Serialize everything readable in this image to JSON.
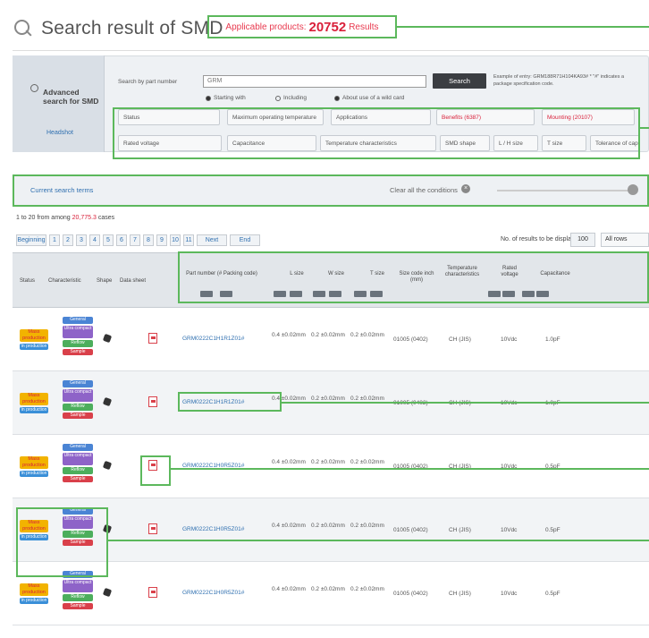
{
  "header": {
    "title": "Search result of SMD",
    "applicable_prefix": "Applicable products:",
    "applicable_count": "20752",
    "applicable_suffix": "Results"
  },
  "advanced": {
    "title": "Advanced search for SMD",
    "link": "Headshot"
  },
  "search": {
    "label": "Search by part number",
    "value": "GRM",
    "button": "Search",
    "example": "Example of entry: GRM188R71H104KA93# * \"#\" indicates a package specification code.",
    "radio_starting": "Starting with",
    "radio_including": "Including",
    "wildcard_note": "About use of a wild card"
  },
  "filters": [
    {
      "label": "Status",
      "red": false
    },
    {
      "label": "Maximum operating temperature",
      "red": false
    },
    {
      "label": "Applications",
      "red": false
    },
    {
      "label": "Benefits (6387)",
      "red": true
    },
    {
      "label": "Mounting (20107)",
      "red": true
    },
    {
      "label": "Rated voltage",
      "red": false
    },
    {
      "label": "Capacitance",
      "red": false
    },
    {
      "label": "Temperature characteristics",
      "red": false
    },
    {
      "label": "SMD shape",
      "red": false
    },
    {
      "label": "L / H size",
      "red": false
    },
    {
      "label": "T size",
      "red": false
    },
    {
      "label": "Tolerance of capacitance",
      "red": false
    }
  ],
  "current": {
    "title": "Current search terms",
    "clear": "Clear all the conditions"
  },
  "results": {
    "count_text": "1 to 20 from among",
    "count_num": "20,775.3",
    "count_suffix": "cases"
  },
  "pagination": {
    "items": [
      "Beginning",
      "1",
      "2",
      "3",
      "4",
      "5",
      "6",
      "7",
      "8",
      "9",
      "10",
      "11",
      "Next",
      "End"
    ]
  },
  "display": {
    "label": "No. of results to be displayed",
    "value": "100",
    "sort": "All rows"
  },
  "columns": {
    "status": "Status",
    "characteristic": "Characteristic",
    "shape": "Shape",
    "datasheet": "Data sheet",
    "part": "Part number (# Packing code)",
    "l": "L size",
    "w": "W size",
    "t": "T size",
    "sizecode": "Size code inch (mm)",
    "temp": "Temperature characteristics",
    "rated": "Rated voltage",
    "cap": "Capacitance"
  },
  "rows": [
    {
      "status": "Mass production",
      "status2": "In production",
      "part": "GRM0222C1H1R1Z01#",
      "l": "0.4 ±0.02mm",
      "w": "0.2 ±0.02mm",
      "t": "0.2 ±0.02mm",
      "size": "01005 (0402)",
      "temp": "CH (JIS)",
      "rated": "10Vdc",
      "cap": "1.0pF"
    },
    {
      "status": "Mass production",
      "status2": "In production",
      "part": "GRM0222C1H1R1Z01#",
      "l": "0.4 ±0.02mm",
      "w": "0.2 ±0.02mm",
      "t": "0.2 ±0.02mm",
      "size": "01005 (0402)",
      "temp": "CH (JIS)",
      "rated": "10Vdc",
      "cap": "1.0pF"
    },
    {
      "status": "Mass production",
      "status2": "In production",
      "part": "GRM0222C1H0R5Z01#",
      "l": "0.4 ±0.02mm",
      "w": "0.2 ±0.02mm",
      "t": "0.2 ±0.02mm",
      "size": "01005 (0402)",
      "temp": "CH (JIS)",
      "rated": "10Vdc",
      "cap": "0.5pF"
    },
    {
      "status": "Mass production",
      "status2": "In production",
      "part": "GRM0222C1H0R5Z01#",
      "l": "0.4 ±0.02mm",
      "w": "0.2 ±0.02mm",
      "t": "0.2 ±0.02mm",
      "size": "01005 (0402)",
      "temp": "CH (JIS)",
      "rated": "10Vdc",
      "cap": "0.5pF"
    },
    {
      "status": "Mass production",
      "status2": "In production",
      "part": "GRM0222C1H0R5Z01#",
      "l": "0.4 ±0.02mm",
      "w": "0.2 ±0.02mm",
      "t": "0.2 ±0.02mm",
      "size": "01005 (0402)",
      "temp": "CH (JIS)",
      "rated": "10Vdc",
      "cap": "0.5pF"
    }
  ],
  "badges": {
    "general": "General",
    "ultra": "Ultra compact",
    "reflow": "Reflow",
    "sample": "Sample"
  },
  "colors": {
    "highlight": "#5cb85c",
    "accent_red": "#d9203a",
    "link": "#3070b0"
  }
}
